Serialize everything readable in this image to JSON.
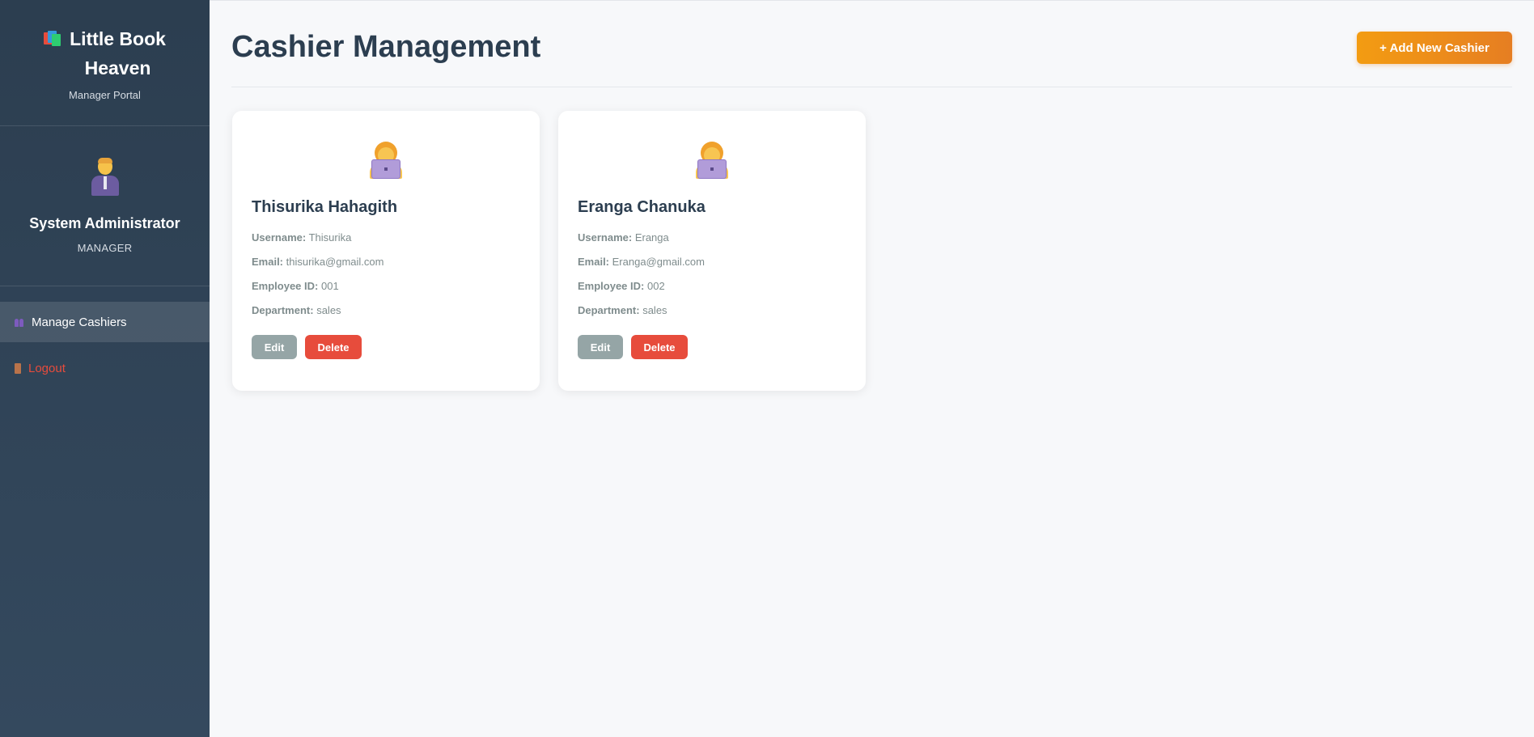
{
  "brand": {
    "title": "Little Book Heaven",
    "subtitle": "Manager Portal"
  },
  "profile": {
    "name": "System Administrator",
    "role": "MANAGER"
  },
  "nav": [
    {
      "label": "Manage Cashiers",
      "icon": "people-icon",
      "active": true
    },
    {
      "label": "Logout",
      "icon": "door-icon",
      "color": "#e74c3c"
    }
  ],
  "header": {
    "title": "Cashier Management",
    "add_button": "+ Add New Cashier"
  },
  "labels": {
    "username": "Username:",
    "email": "Email:",
    "employee_id": "Employee ID:",
    "department": "Department:",
    "edit": "Edit",
    "delete": "Delete"
  },
  "cashiers": [
    {
      "name": "Thisurika Hahagith",
      "username": "Thisurika",
      "email": "thisurika@gmail.com",
      "employee_id": "001",
      "department": "sales"
    },
    {
      "name": "Eranga Chanuka",
      "username": "Eranga",
      "email": "Eranga@gmail.com",
      "employee_id": "002",
      "department": "sales"
    }
  ],
  "colors": {
    "sidebar": "#2c3e50",
    "accent": "#f39c12",
    "danger": "#e74c3c",
    "edit": "#95a5a6",
    "title": "#2c3e50"
  }
}
